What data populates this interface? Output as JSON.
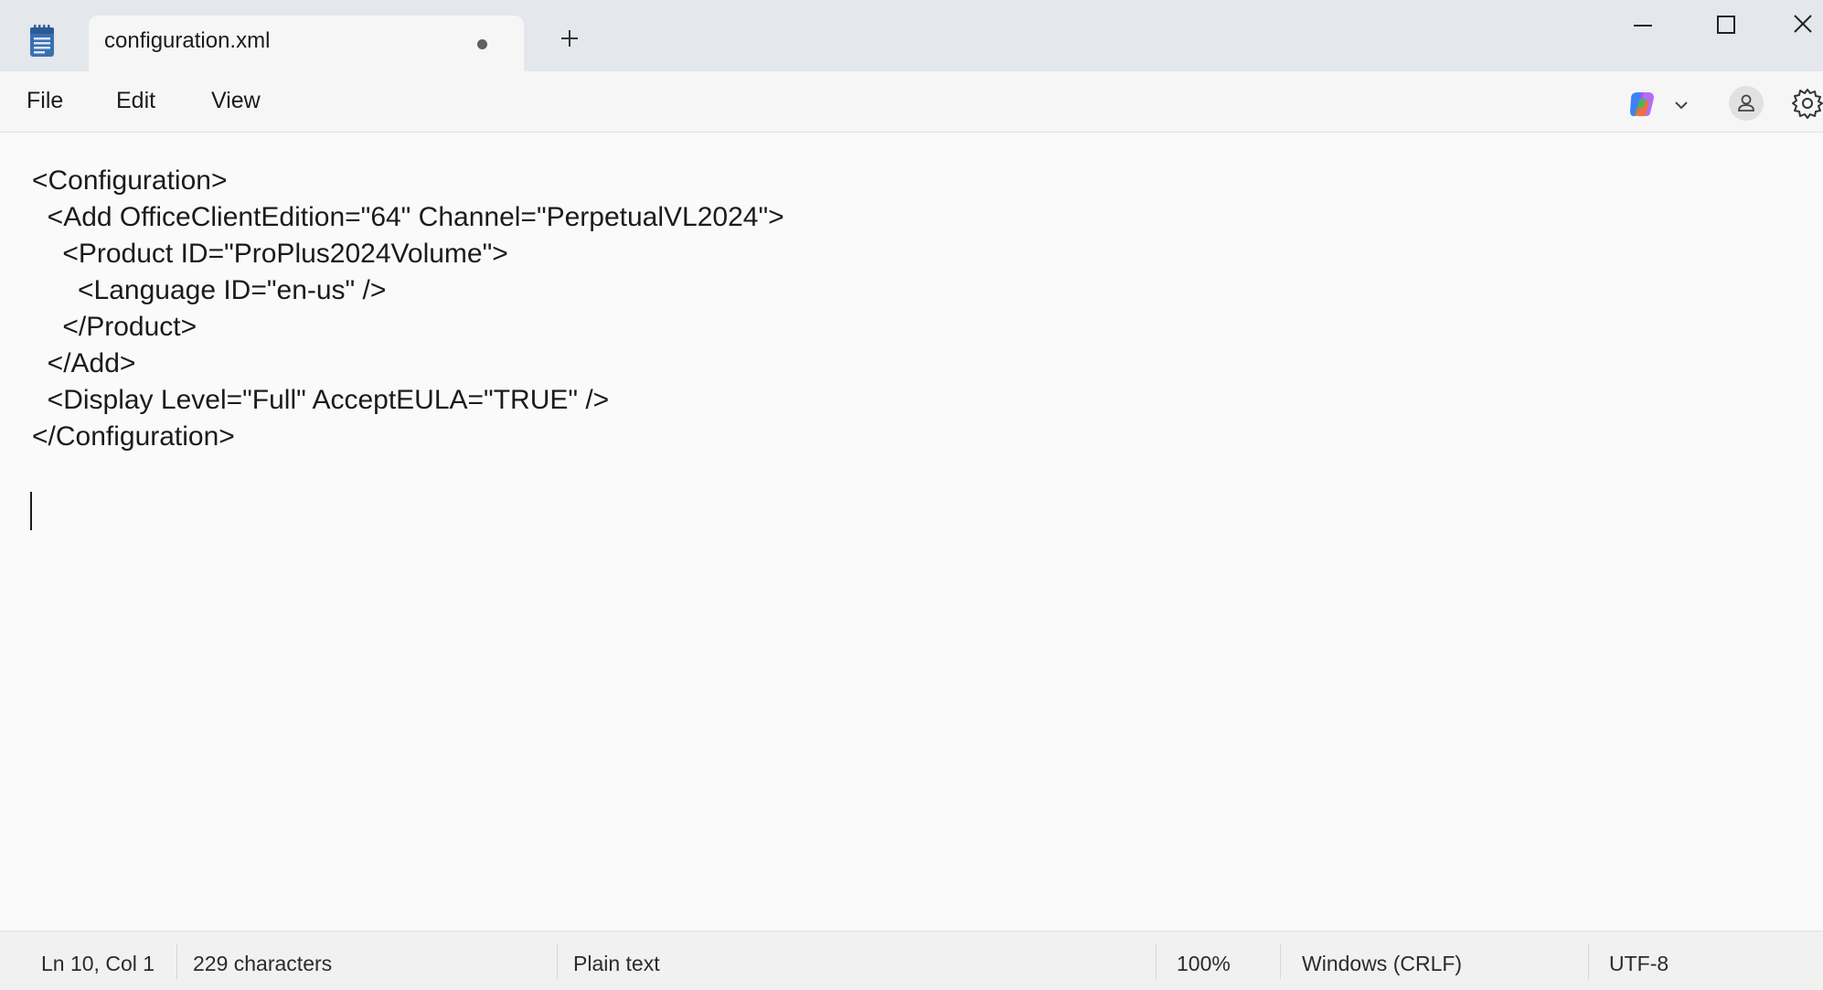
{
  "tab": {
    "title": "configuration.xml"
  },
  "menu": {
    "file": "File",
    "edit": "Edit",
    "view": "View"
  },
  "editor": {
    "lines": [
      "<Configuration>",
      "  <Add OfficeClientEdition=\"64\" Channel=\"PerpetualVL2024\">",
      "    <Product ID=\"ProPlus2024Volume\">",
      "      <Language ID=\"en-us\" />",
      "    </Product>",
      "  </Add>",
      "  <Display Level=\"Full\" AcceptEULA=\"TRUE\" />",
      "</Configuration>"
    ]
  },
  "status": {
    "position": "Ln 10, Col 1",
    "characters": "229 characters",
    "format": "Plain text",
    "zoom": "100%",
    "line_ending": "Windows (CRLF)",
    "encoding": "UTF-8"
  },
  "icons": {
    "app": "notepad-icon",
    "new_tab": "plus-icon",
    "minimize": "minimize-icon",
    "maximize": "maximize-icon",
    "close": "close-icon",
    "copilot": "copilot-icon",
    "copilot_menu": "chevron-down-icon",
    "account": "account-icon",
    "settings": "gear-icon"
  },
  "colors": {
    "titlebar": "#e4e7ec",
    "tab": "#f6f6f6",
    "editor": "#fafafa",
    "notepad_icon": "#3a6fb0"
  }
}
